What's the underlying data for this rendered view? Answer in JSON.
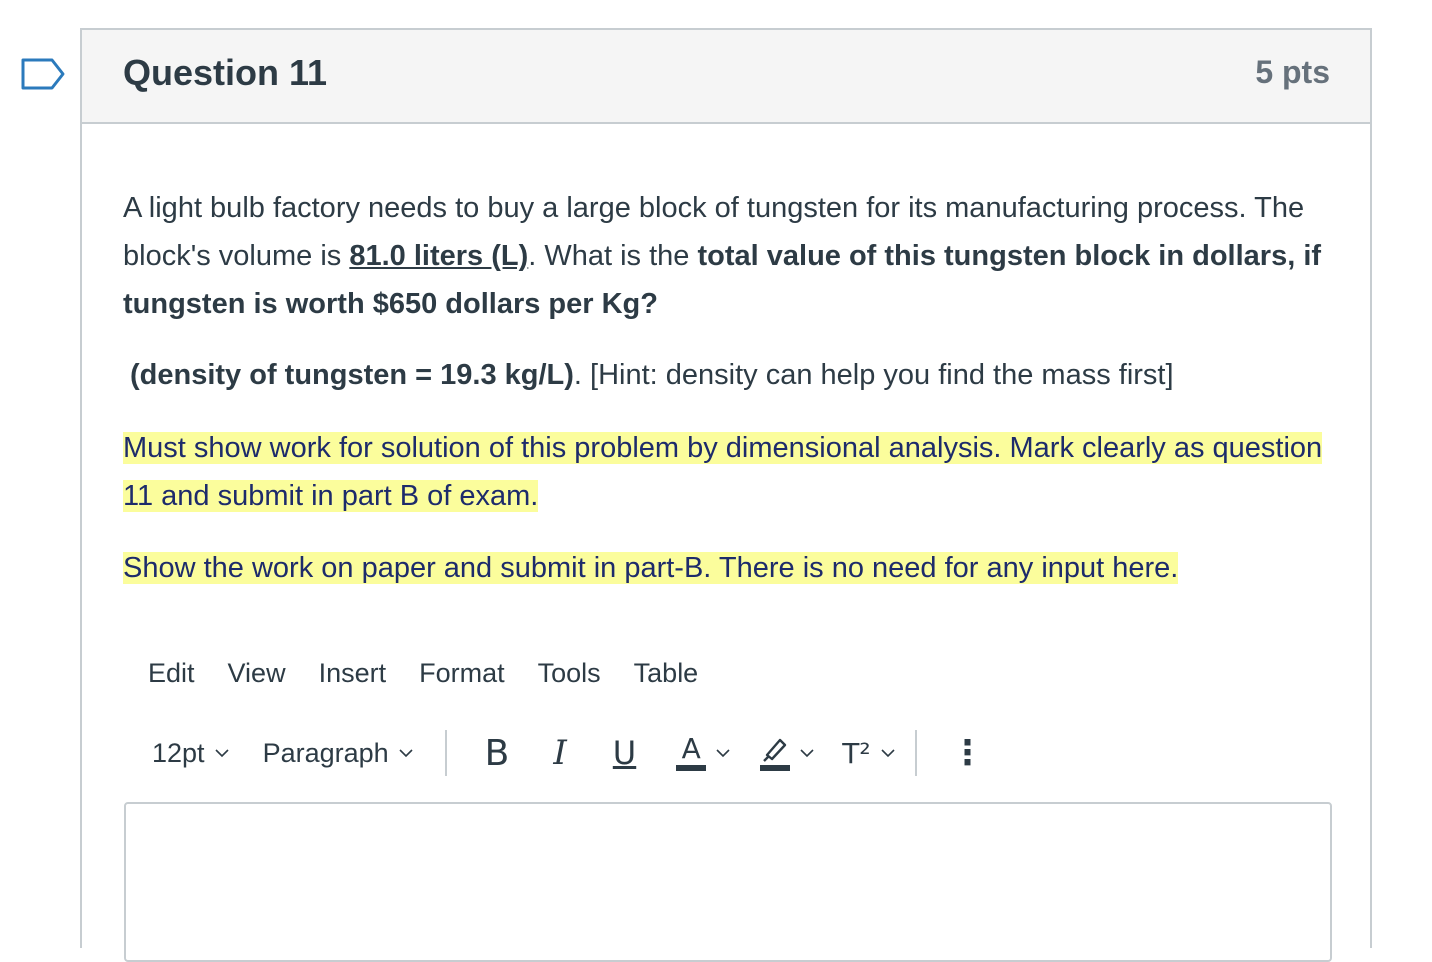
{
  "question": {
    "title": "Question 11",
    "points": "5 pts",
    "text1_a": "A light bulb factory needs to buy a large block of tungsten for its manufacturing process. The block's volume is ",
    "text1_vol": "81.0 liters (L)",
    "text1_b": ".  What is the ",
    "text1_bold": "total value of this tungsten block in dollars, if tungsten is worth $650 dollars per Kg?",
    "density_bold": "(density of tungsten = 19.3 kg/L)",
    "density_rest": ".   [Hint: density can help you find the mass first]",
    "instruction1": "Must show work for solution of this problem by dimensional analysis. Mark clearly as question 11 and submit in part B of exam. ",
    "instruction2": "Show the work on paper and submit in part-B.  There is no need for any input here. "
  },
  "editor": {
    "menu": [
      "Edit",
      "View",
      "Insert",
      "Format",
      "Tools",
      "Table"
    ],
    "font_size": "12pt",
    "block_format": "Paragraph",
    "bold_label": "B",
    "italic_label": "I",
    "underline_label": "U",
    "text_color_label": "A",
    "superscript_label": "T²",
    "more_label": "⋮"
  },
  "colors": {
    "highlight": "#fbfd9c",
    "flag_border": "#2b7abc"
  },
  "icons": [
    "bookmark-flag-icon",
    "chevron-down-icon",
    "highlighter-icon",
    "more-icon"
  ]
}
